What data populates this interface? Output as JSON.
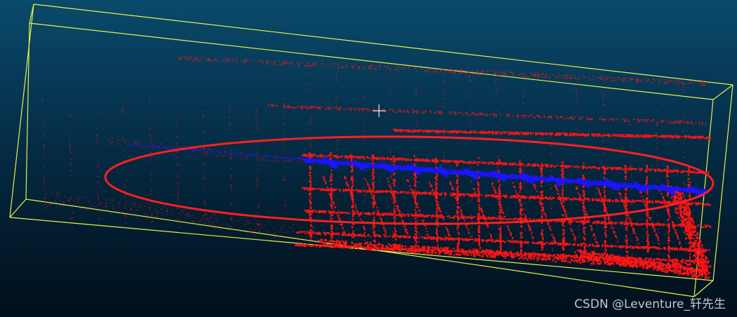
{
  "viewer": {
    "background_top": "#0a4a6b",
    "background_bottom": "#020f1b",
    "bounding_box_color": "#e6f04a",
    "cloud_color": "#ff1414",
    "highlight_color": "#1a14ff",
    "annotation_color": "#ff2020",
    "cursor_color": "#e8e8e8"
  },
  "watermark": {
    "text": "CSDN @Leventure_轩先生"
  }
}
